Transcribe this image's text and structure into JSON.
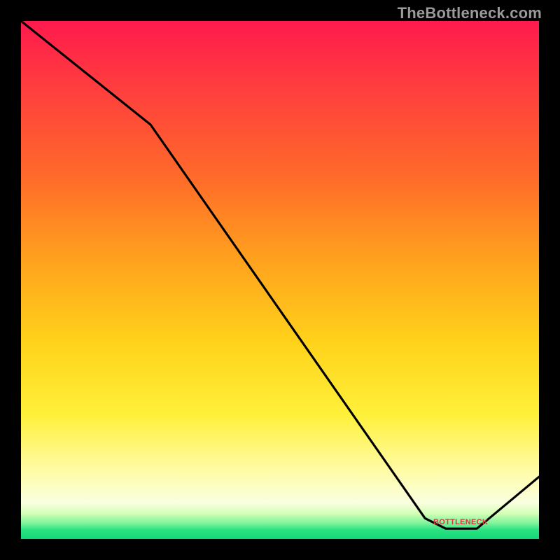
{
  "watermark": "TheBottleneck.com",
  "chart_data": {
    "type": "line",
    "title": "",
    "xlabel": "",
    "ylabel": "",
    "xlim": [
      0,
      100
    ],
    "ylim": [
      0,
      100
    ],
    "grid": false,
    "series": [
      {
        "name": "curve",
        "x": [
          0,
          25,
          78,
          82,
          88,
          100
        ],
        "values": [
          100,
          80,
          4,
          2,
          2,
          12
        ]
      }
    ],
    "annotations": [
      {
        "name": "bottom-label",
        "text": "BOTTLENECK",
        "x": 85,
        "y": 3
      }
    ],
    "background_gradient": {
      "top": "#ff1a4d",
      "mid_upper": "#ff9e1e",
      "mid": "#fff03a",
      "lower": "#f9ffe0",
      "bottom": "#11d877"
    }
  },
  "colors": {
    "line": "#000000",
    "label": "#d23b3b",
    "watermark": "#9a9a9a"
  }
}
